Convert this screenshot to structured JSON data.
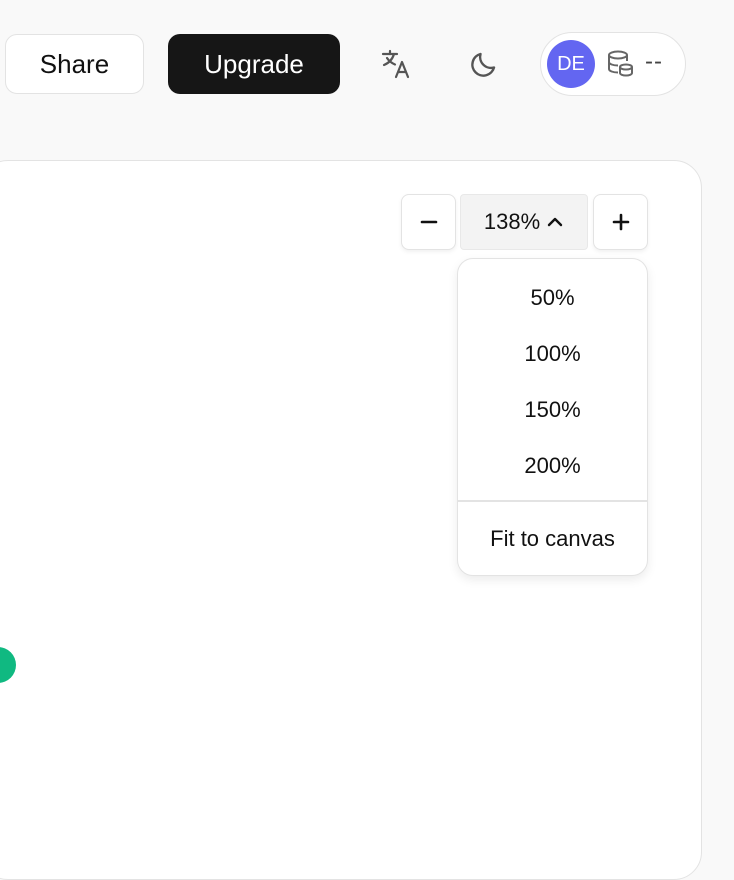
{
  "header": {
    "share_label": "Share",
    "upgrade_label": "Upgrade",
    "translate_icon": "translate-icon",
    "theme_icon": "moon-icon",
    "account": {
      "avatar_initials": "DE",
      "avatar_color": "#6366f1",
      "credits_icon": "database-icon",
      "credits_value": "--"
    }
  },
  "zoom": {
    "minus_label": "−",
    "plus_label": "+",
    "current": "138%",
    "options": [
      "50%",
      "100%",
      "150%",
      "200%"
    ],
    "fit_label": "Fit to canvas"
  },
  "colors": {
    "accent_dark": "#161616",
    "status_dot": "#10b981"
  }
}
